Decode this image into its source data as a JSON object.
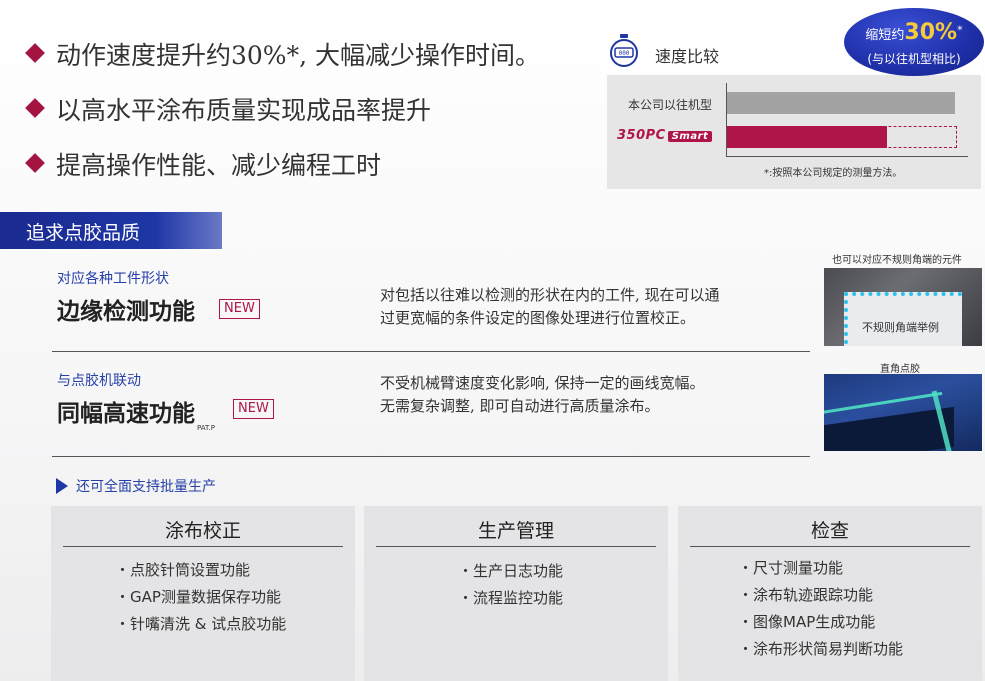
{
  "bullets": [
    "动作速度提升约30%*, 大幅减少操作时间。",
    "以高水平涂布质量实现成品率提升",
    "提高操作性能、减少编程工时"
  ],
  "speed_chart": {
    "title": "速度比较",
    "badge": {
      "prefix": "缩短约",
      "value": "30%",
      "mark": "*",
      "note": "(与以往机型相比)"
    },
    "bars": [
      {
        "label": "本公司以往机型",
        "relative": 1.0
      },
      {
        "label": "350PC Smart",
        "relative": 0.7
      }
    ],
    "logo": {
      "main": "350PC",
      "sub": "Smart"
    },
    "footnote": "*:按照本公司规定的测量方法。",
    "colors": {
      "old": "#a3a3a3",
      "new": "#b0154a"
    }
  },
  "section": {
    "title": "追求点胶品质"
  },
  "features": [
    {
      "subtitle": "对应各种工件形状",
      "title": "边缘检测功能",
      "tag": "NEW",
      "desc1": "对包括以往难以检测的形状在内的工件, 现在可以通",
      "desc2": "过更宽幅的条件设定的图像处理进行位置校正。"
    },
    {
      "subtitle": "与点胶机联动",
      "title": "同幅高速功能",
      "tag": "NEW",
      "pat": "PAT.P",
      "desc1": "不受机械臂速度变化影响, 保持一定的画线宽幅。",
      "desc2": "无需复杂调整, 即可自动进行高质量涂布。"
    }
  ],
  "images": {
    "caption_top": "也可以对应不规则角端的元件",
    "panel_text": "不规则角端举例",
    "caption_mid": "直角点胶"
  },
  "more": "还可全面支持批量生产",
  "cards": [
    {
      "title": "涂布校正",
      "items": [
        "点胶针筒设置功能",
        "GAP测量数据保存功能",
        "针嘴清洗 & 试点胶功能"
      ]
    },
    {
      "title": "生产管理",
      "items": [
        "生产日志功能",
        "流程监控功能"
      ]
    },
    {
      "title": "检查",
      "items": [
        "尺寸测量功能",
        "涂布轨迹跟踪功能",
        "图像MAP生成功能",
        "涂布形状简易判断功能"
      ]
    }
  ]
}
